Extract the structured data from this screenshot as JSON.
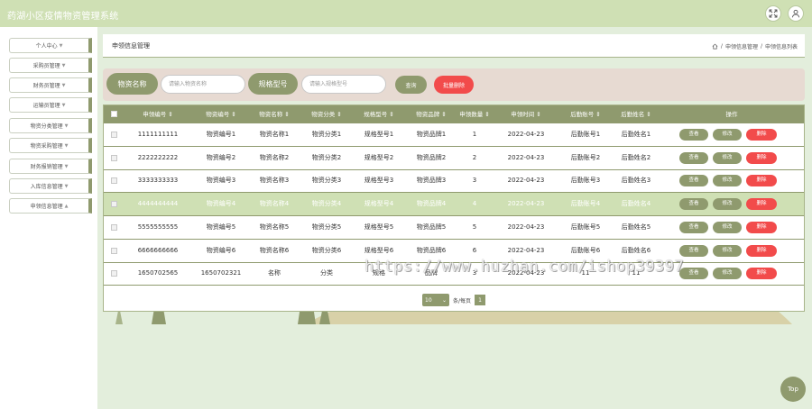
{
  "app": {
    "title": "药湖小区疫情物资管理系统"
  },
  "topbar": {
    "fullscreen_icon": "expand-icon",
    "user_icon": "user-icon"
  },
  "sidebar": {
    "items": [
      {
        "label": "个人中心"
      },
      {
        "label": "采购员管理"
      },
      {
        "label": "财务员管理"
      },
      {
        "label": "运输员管理"
      },
      {
        "label": "物资分类管理"
      },
      {
        "label": "物资采购管理"
      },
      {
        "label": "财务报销管理"
      },
      {
        "label": "入库信息管理"
      },
      {
        "label": "申领信息管理"
      }
    ]
  },
  "page": {
    "title": "申领信息管理",
    "breadcrumb": [
      "申领信息管理",
      "申领信息列表"
    ]
  },
  "search": {
    "name_label": "物资名称",
    "name_placeholder": "请输入物资名称",
    "spec_label": "规格型号",
    "spec_placeholder": "请输入规格型号",
    "query_label": "查询",
    "batch_delete_label": "批量删除"
  },
  "table": {
    "headers": [
      "申领编号",
      "物资编号",
      "物资名称",
      "物资分类",
      "规格型号",
      "物资品牌",
      "申领数量",
      "申领时间",
      "后勤账号",
      "后勤姓名",
      "操作"
    ],
    "action_labels": {
      "view": "查看",
      "edit": "修改",
      "delete": "删除"
    },
    "highlighted_row": 3,
    "rows": [
      [
        "1111111111",
        "物资编号1",
        "物资名称1",
        "物资分类1",
        "规格型号1",
        "物资品牌1",
        "1",
        "2022-04-23",
        "后勤账号1",
        "后勤姓名1"
      ],
      [
        "2222222222",
        "物资编号2",
        "物资名称2",
        "物资分类2",
        "规格型号2",
        "物资品牌2",
        "2",
        "2022-04-23",
        "后勤账号2",
        "后勤姓名2"
      ],
      [
        "3333333333",
        "物资编号3",
        "物资名称3",
        "物资分类3",
        "规格型号3",
        "物资品牌3",
        "3",
        "2022-04-23",
        "后勤账号3",
        "后勤姓名3"
      ],
      [
        "4444444444",
        "物资编号4",
        "物资名称4",
        "物资分类4",
        "规格型号4",
        "物资品牌4",
        "4",
        "2022-04-23",
        "后勤账号4",
        "后勤姓名4"
      ],
      [
        "5555555555",
        "物资编号5",
        "物资名称5",
        "物资分类5",
        "规格型号5",
        "物资品牌5",
        "5",
        "2022-04-23",
        "后勤账号5",
        "后勤姓名5"
      ],
      [
        "6666666666",
        "物资编号6",
        "物资名称6",
        "物资分类6",
        "规格型号6",
        "物资品牌6",
        "6",
        "2022-04-23",
        "后勤账号6",
        "后勤姓名6"
      ],
      [
        "1650702565",
        "1650702321",
        "名称",
        "分类",
        "规格",
        "品牌",
        "3",
        "2022-04-23",
        "11",
        "11"
      ]
    ]
  },
  "pagination": {
    "page_size": "10",
    "page_size_suffix": "条/每页",
    "current_page": "1"
  },
  "watermark": "https://www.huzhan.com/ishop39397",
  "top_button": "Top",
  "colors": {
    "accent": "#8f9a6e",
    "danger": "#f24b4b",
    "topbar": "#cfe0b4",
    "highlight_row": "#cfe0b4",
    "search_panel": "#e7dad2"
  }
}
